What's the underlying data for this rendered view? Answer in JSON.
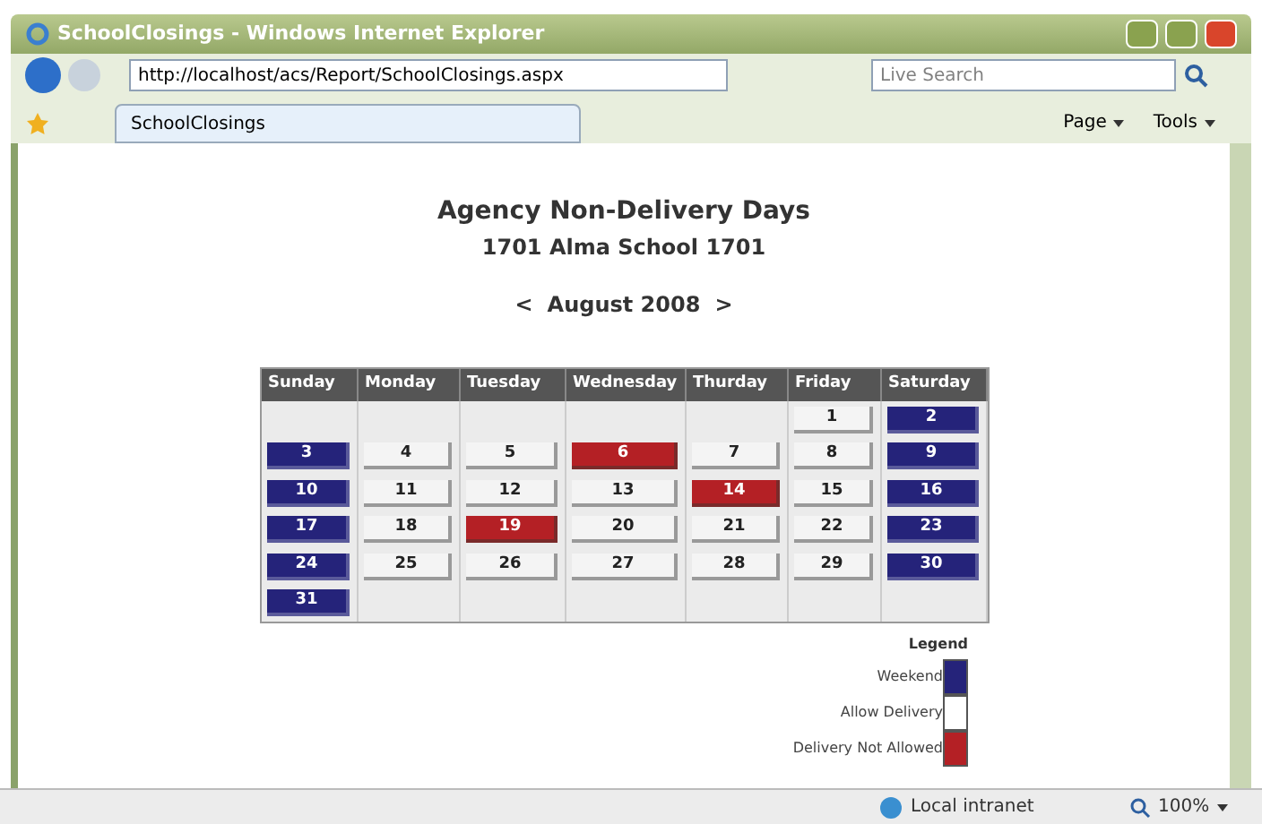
{
  "window": {
    "title": "SchoolClosings - Windows Internet Explorer"
  },
  "address_bar": {
    "url": "http://localhost/acs/Report/SchoolClosings.aspx"
  },
  "search": {
    "placeholder": "Live Search"
  },
  "tabs": [
    {
      "label": "SchoolClosings",
      "selected": true
    }
  ],
  "command_bar": [
    "Page",
    "Tools"
  ],
  "report": {
    "title": "Agency Non-Delivery Days",
    "subtitle": "1701 Alma School 1701",
    "prev": "<",
    "month": "August 2008",
    "next": ">"
  },
  "calendar": {
    "columns": [
      "Sunday",
      "Monday",
      "Tuesday",
      "Wednesday",
      "Thurday",
      "Friday",
      "Saturday"
    ],
    "weeks": [
      [
        {
          "kind": "empty"
        },
        {
          "kind": "empty"
        },
        {
          "kind": "empty"
        },
        {
          "kind": "empty"
        },
        {
          "kind": "empty"
        },
        {
          "day": "1",
          "kind": "allow"
        },
        {
          "day": "2",
          "kind": "weekend"
        }
      ],
      [
        {
          "day": "3",
          "kind": "weekend"
        },
        {
          "day": "4",
          "kind": "allow"
        },
        {
          "day": "5",
          "kind": "allow"
        },
        {
          "day": "6",
          "kind": "blocked"
        },
        {
          "day": "7",
          "kind": "allow"
        },
        {
          "day": "8",
          "kind": "allow"
        },
        {
          "day": "9",
          "kind": "weekend"
        }
      ],
      [
        {
          "day": "10",
          "kind": "weekend"
        },
        {
          "day": "11",
          "kind": "allow"
        },
        {
          "day": "12",
          "kind": "allow"
        },
        {
          "day": "13",
          "kind": "allow"
        },
        {
          "day": "14",
          "kind": "blocked"
        },
        {
          "day": "15",
          "kind": "allow"
        },
        {
          "day": "16",
          "kind": "weekend"
        }
      ],
      [
        {
          "day": "17",
          "kind": "weekend"
        },
        {
          "day": "18",
          "kind": "allow"
        },
        {
          "day": "19",
          "kind": "blocked"
        },
        {
          "day": "20",
          "kind": "allow"
        },
        {
          "day": "21",
          "kind": "allow"
        },
        {
          "day": "22",
          "kind": "allow"
        },
        {
          "day": "23",
          "kind": "weekend"
        }
      ],
      [
        {
          "day": "24",
          "kind": "weekend"
        },
        {
          "day": "25",
          "kind": "allow"
        },
        {
          "day": "26",
          "kind": "allow"
        },
        {
          "day": "27",
          "kind": "allow"
        },
        {
          "day": "28",
          "kind": "allow"
        },
        {
          "day": "29",
          "kind": "allow"
        },
        {
          "day": "30",
          "kind": "weekend"
        }
      ],
      [
        {
          "day": "31",
          "kind": "weekend"
        },
        {
          "kind": "empty"
        },
        {
          "kind": "empty"
        },
        {
          "kind": "empty"
        },
        {
          "kind": "empty"
        },
        {
          "kind": "empty"
        },
        {
          "kind": "empty"
        }
      ]
    ]
  },
  "legend": {
    "title": "Legend",
    "items": [
      {
        "label": "Weekend",
        "kind": "weekend"
      },
      {
        "label": "Allow Delivery",
        "kind": "allow"
      },
      {
        "label": "Delivery Not Allowed",
        "kind": "blocked"
      }
    ]
  },
  "status_bar": {
    "zone": "Local intranet",
    "zoom": "100%"
  }
}
